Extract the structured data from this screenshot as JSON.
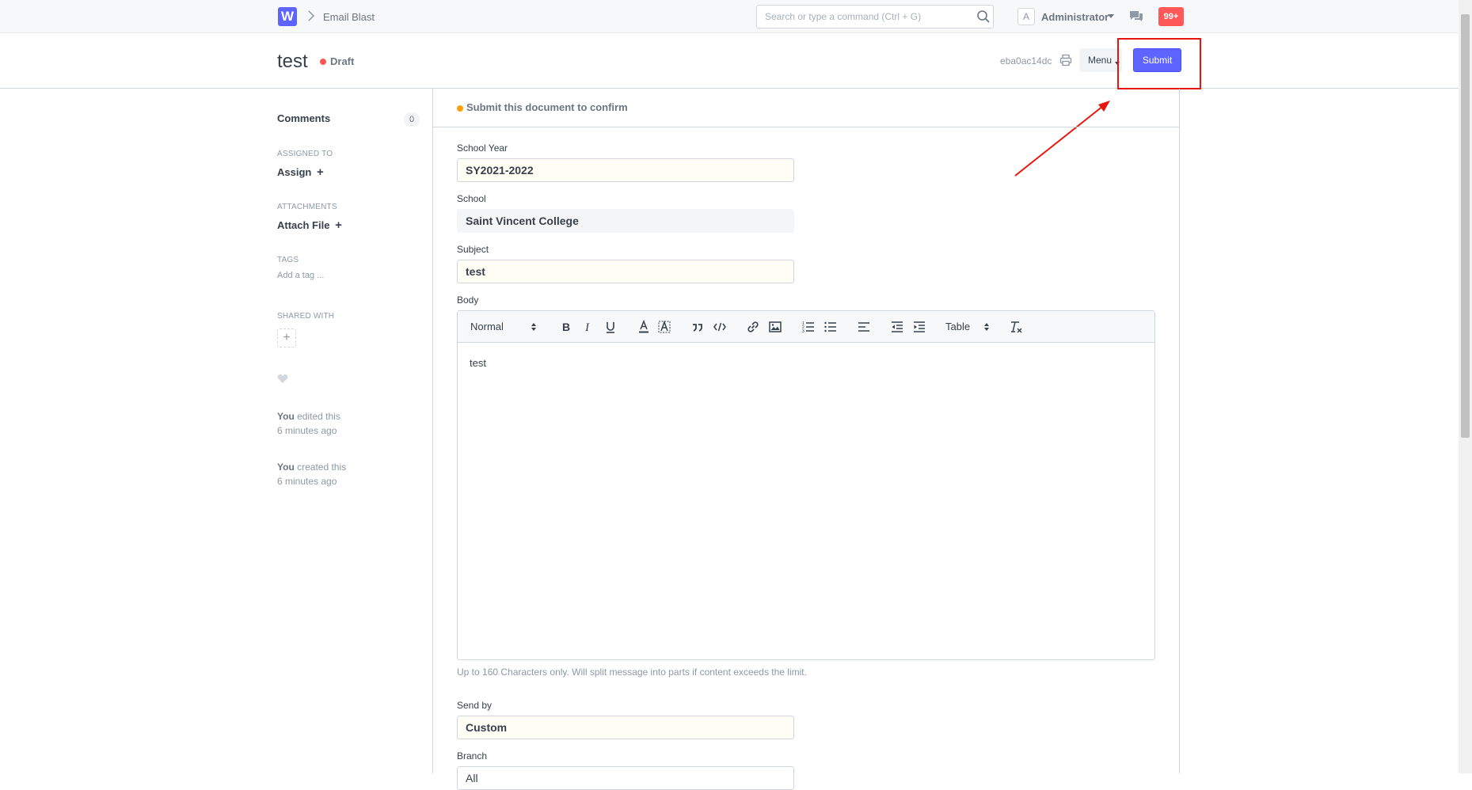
{
  "navbar": {
    "logo_letter": "W",
    "breadcrumb": "Email Blast",
    "search_placeholder": "Search or type a command (Ctrl + G)",
    "avatar_letter": "A",
    "user": "Administrator",
    "notifications": "99+"
  },
  "header": {
    "title": "test",
    "status": "Draft",
    "doc_id": "eba0ac14dc",
    "menu_label": "Menu",
    "submit_label": "Submit"
  },
  "sidebar": {
    "comments_label": "Comments",
    "comments_count": "0",
    "assigned_to_label": "ASSIGNED TO",
    "assign_label": "Assign",
    "attachments_label": "ATTACHMENTS",
    "attach_label": "Attach File",
    "tags_label": "TAGS",
    "add_tag": "Add a tag ...",
    "shared_with_label": "SHARED WITH",
    "share_add": "+",
    "timeline": [
      {
        "who": "You",
        "action": " edited this",
        "when": "6 minutes ago"
      },
      {
        "who": "You",
        "action": " created this",
        "when": "6 minutes ago"
      }
    ]
  },
  "form": {
    "message": "Submit this document to confirm",
    "school_year": {
      "label": "School Year",
      "value": "SY2021-2022"
    },
    "school": {
      "label": "School",
      "value": "Saint Vincent College"
    },
    "subject": {
      "label": "Subject",
      "value": "test"
    },
    "body": {
      "label": "Body",
      "toolbar": {
        "heading": "Normal",
        "table": "Table"
      },
      "content": "test",
      "help": "Up to 160 Characters only. Will split message into parts if content exceeds the limit."
    },
    "send_by": {
      "label": "Send by",
      "value": "Custom"
    },
    "branch": {
      "label": "Branch",
      "value": "All"
    }
  },
  "colors": {
    "primary": "#5e64ff",
    "draft_indicator": "#ff5858",
    "message_indicator": "#ffa00a",
    "annotation_red": "#e8150e"
  }
}
